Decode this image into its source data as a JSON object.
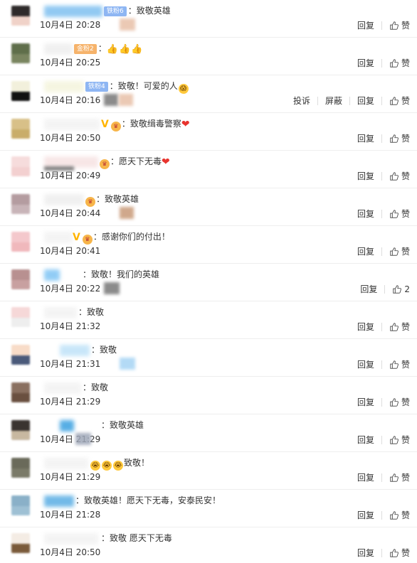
{
  "labels": {
    "reply": "回复",
    "like": "赞",
    "report": "投诉",
    "block": "屏蔽"
  },
  "badges": {
    "fan6": "铁粉6",
    "gold2": "金粉2",
    "fan4": "铁粉4"
  },
  "colors": {
    "separator": "#eeeeee",
    "text": "#333333",
    "badge_blue": "#8eb6f3",
    "badge_orange": "#f6b36b",
    "heart": "#e8342e",
    "verified": "#ffb400"
  },
  "comments": [
    {
      "text": "：致敬英雄",
      "time": "10月4日 20:28",
      "like": "赞"
    },
    {
      "text": "：",
      "time": "10月4日 20:25",
      "like": "赞"
    },
    {
      "text": "：致敬！可爱的人",
      "time": "10月4日 20:16",
      "like": "赞"
    },
    {
      "text": "：致敬缉毒警察",
      "time": "10月4日 20:50",
      "like": "赞"
    },
    {
      "text": "：愿天下无毒",
      "time": "10月4日 20:49",
      "like": "赞"
    },
    {
      "text": "：致敬英雄",
      "time": "10月4日 20:44",
      "like": "赞"
    },
    {
      "text": "：感谢你们的付出！",
      "time": "10月4日 20:41",
      "like": "赞"
    },
    {
      "text": "：致敬！我们的英雄",
      "time": "10月4日 20:22",
      "like": "2"
    },
    {
      "text": "：致敬",
      "time": "10月4日 21:32",
      "like": "赞"
    },
    {
      "text": "：致敬",
      "time": "10月4日 21:31",
      "like": "赞"
    },
    {
      "text": "：致敬",
      "time": "10月4日 21:29",
      "like": "赞"
    },
    {
      "text": "：致敬英雄",
      "time": "10月4日 21:29",
      "like": "赞"
    },
    {
      "text": "致敬！",
      "time": "10月4日 21:29",
      "like": "赞"
    },
    {
      "text": "：致敬英雄！愿天下无毒，安泰民安！",
      "time": "10月4日 21:28",
      "like": "赞"
    },
    {
      "text": "：致敬 愿天下无毒",
      "time": "10月4日 20:50",
      "like": "赞"
    }
  ]
}
